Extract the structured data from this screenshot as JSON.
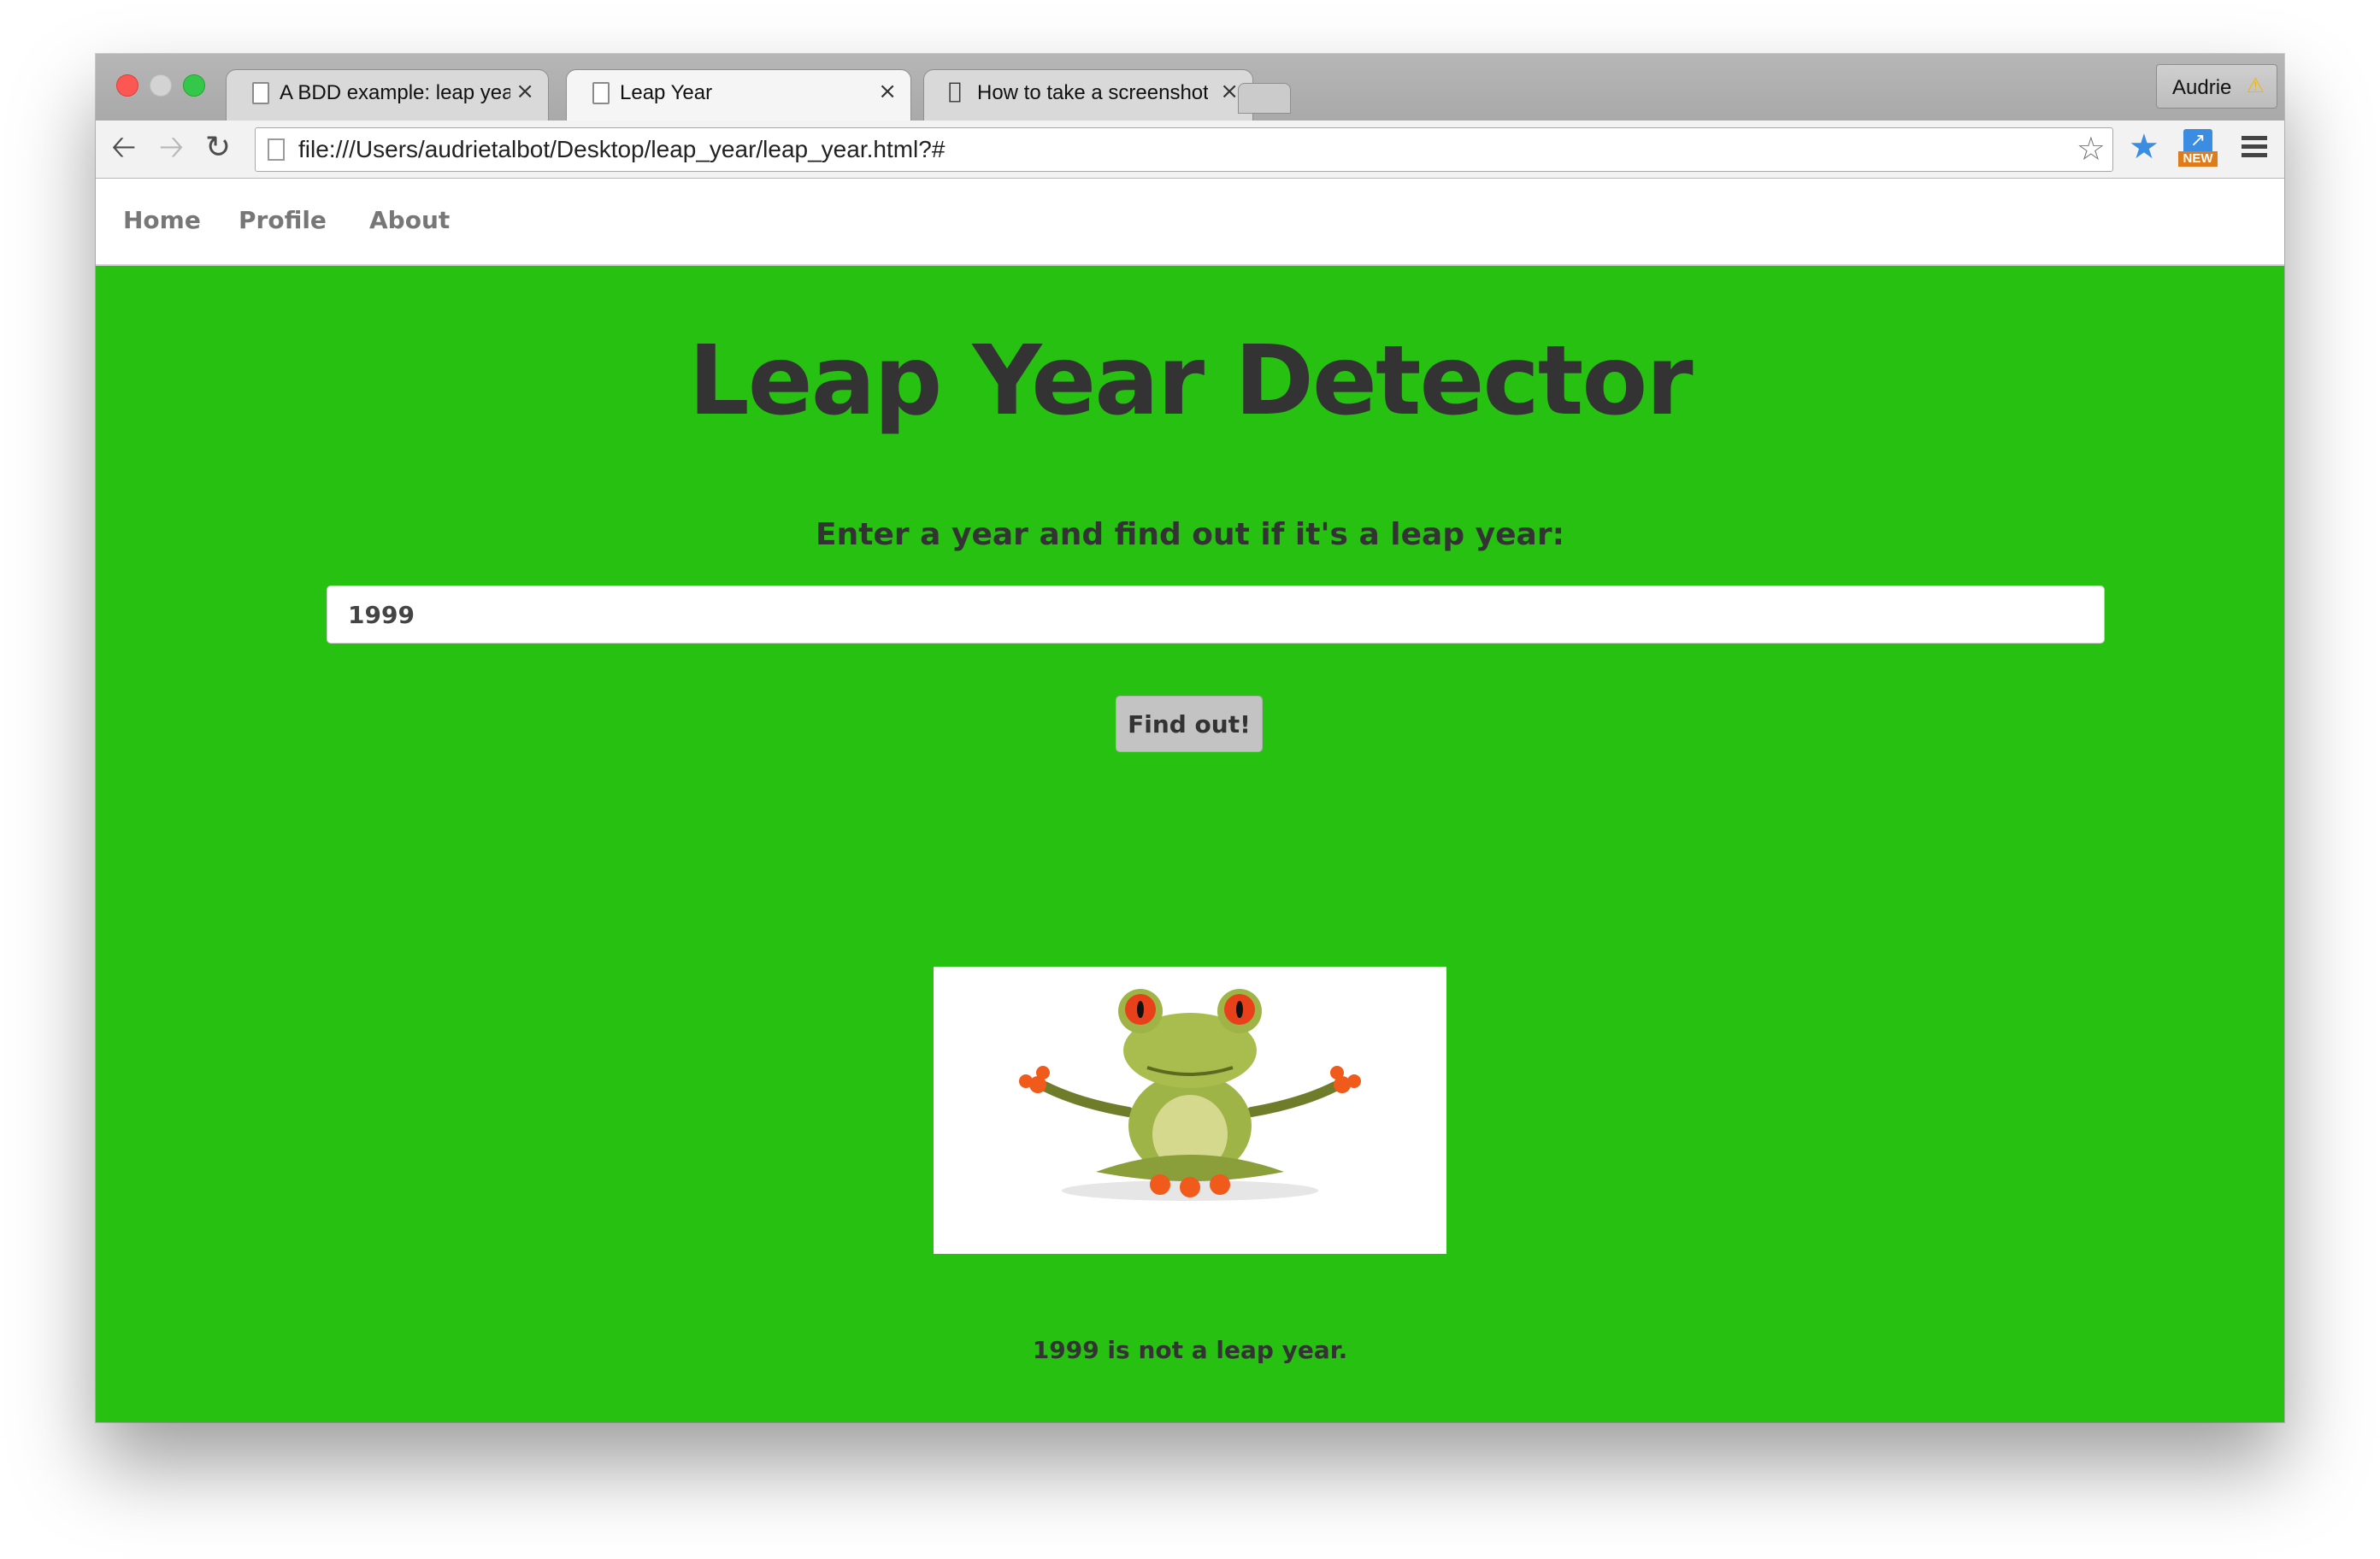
{
  "browser": {
    "tabs": [
      {
        "title": "A BDD example: leap year",
        "icon": "document-icon",
        "active": false
      },
      {
        "title": "Leap Year",
        "icon": "document-icon",
        "active": true
      },
      {
        "title": "How to take a screenshot",
        "icon": "apple-icon",
        "active": false
      }
    ],
    "close_glyph": "×",
    "profile_name": "Audrie",
    "address_url": "file:///Users/audrietalbot/Desktop/leap_year/leap_year.html?#",
    "extension_badge": "NEW"
  },
  "nav": {
    "items": [
      "Home",
      "Profile",
      "About"
    ]
  },
  "main": {
    "title": "Leap Year Detector",
    "prompt": "Enter a year and find out if it's a leap year:",
    "year_value": "1999",
    "button_label": "Find out!",
    "result_text": "1999 is not a leap year."
  },
  "colors": {
    "page_background": "#27c112",
    "text": "#333333",
    "button_background": "#c3c3c3"
  }
}
